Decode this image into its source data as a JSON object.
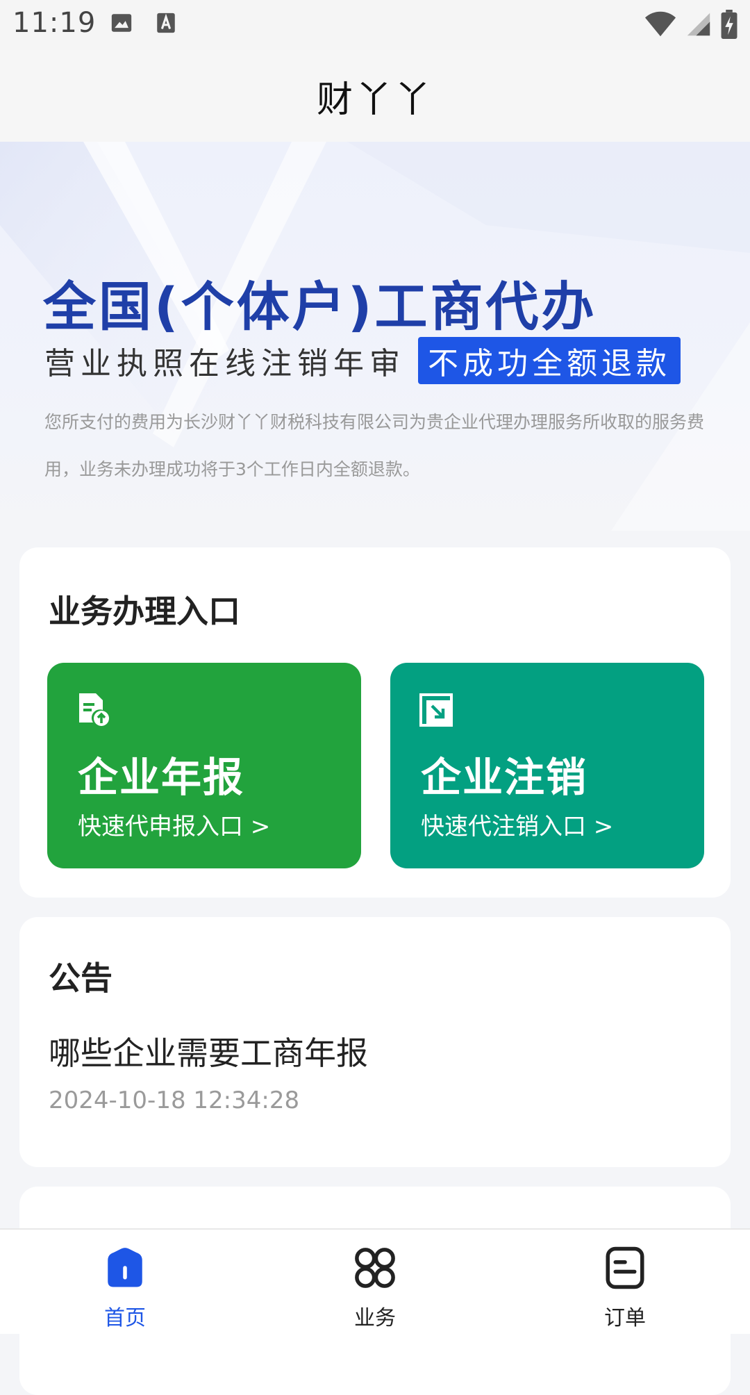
{
  "status_bar": {
    "time": "11:19",
    "icons": [
      "image-icon",
      "font-icon",
      "wifi-icon",
      "signal-icon",
      "battery-charging-icon"
    ]
  },
  "header": {
    "title": "财丫丫"
  },
  "banner": {
    "headline": "全国(个体户)工商代办",
    "subline": "营业执照在线注销年审",
    "badge": "不成功全额退款",
    "description": "您所支付的费用为长沙财丫丫财税科技有限公司为贵企业代理办理服务所收取的服务费用，业务未办理成功将于3个工作日内全额退款。"
  },
  "entry_card": {
    "title": "业务办理入口",
    "tiles": [
      {
        "title": "企业年报",
        "subtitle": "快速代申报入口 >",
        "icon": "document-upload-icon",
        "color": "#22a33d"
      },
      {
        "title": "企业注销",
        "subtitle": "快速代注销入口 >",
        "icon": "exit-arrow-icon",
        "color": "#03a081"
      }
    ]
  },
  "notice_card": {
    "title": "公告",
    "items": [
      {
        "headline": "哪些企业需要工商年报",
        "time": "2024-10-18 12:34:28"
      }
    ]
  },
  "bottom_nav": {
    "accent": "#1e56e6",
    "items": [
      {
        "label": "首页",
        "icon": "home-icon",
        "active": true
      },
      {
        "label": "业务",
        "icon": "grid-icon",
        "active": false
      },
      {
        "label": "订单",
        "icon": "order-icon",
        "active": false
      }
    ]
  }
}
